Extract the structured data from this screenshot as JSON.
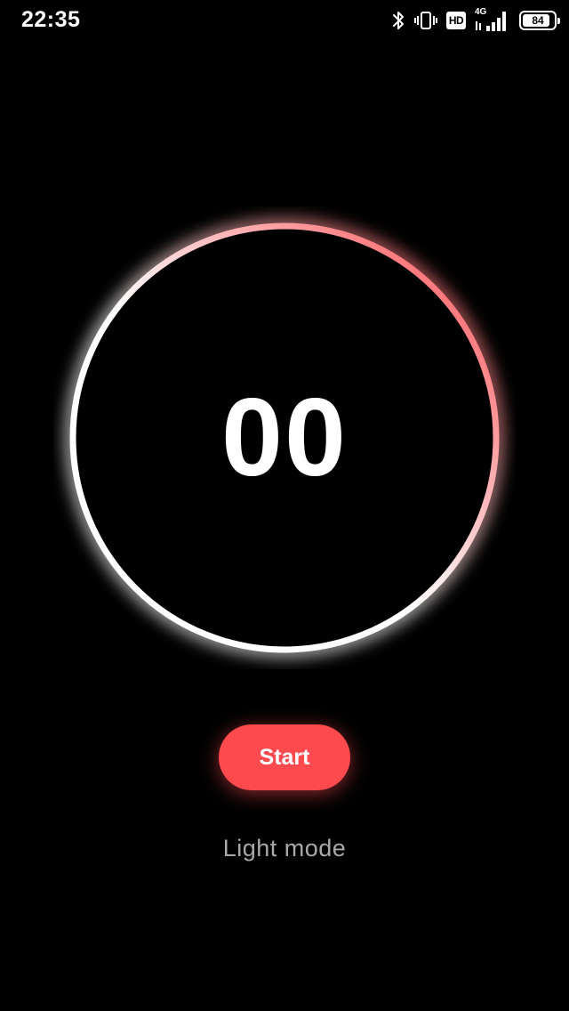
{
  "status_bar": {
    "time": "22:35",
    "icons": [
      "bluetooth-icon",
      "vibrate-icon",
      "hd-icon",
      "signal-4g-icon",
      "battery-icon"
    ],
    "hd_label": "HD",
    "network_label": "4G",
    "battery_level": "84"
  },
  "timer": {
    "value": "00",
    "ring_colors": {
      "start": "#ffffff",
      "end": "#fc4a4f"
    }
  },
  "controls": {
    "start_label": "Start",
    "mode_toggle_label": "Light mode"
  },
  "colors": {
    "background": "#000000",
    "accent": "#fc4a4f",
    "secondary_text": "#a9a9a9"
  }
}
